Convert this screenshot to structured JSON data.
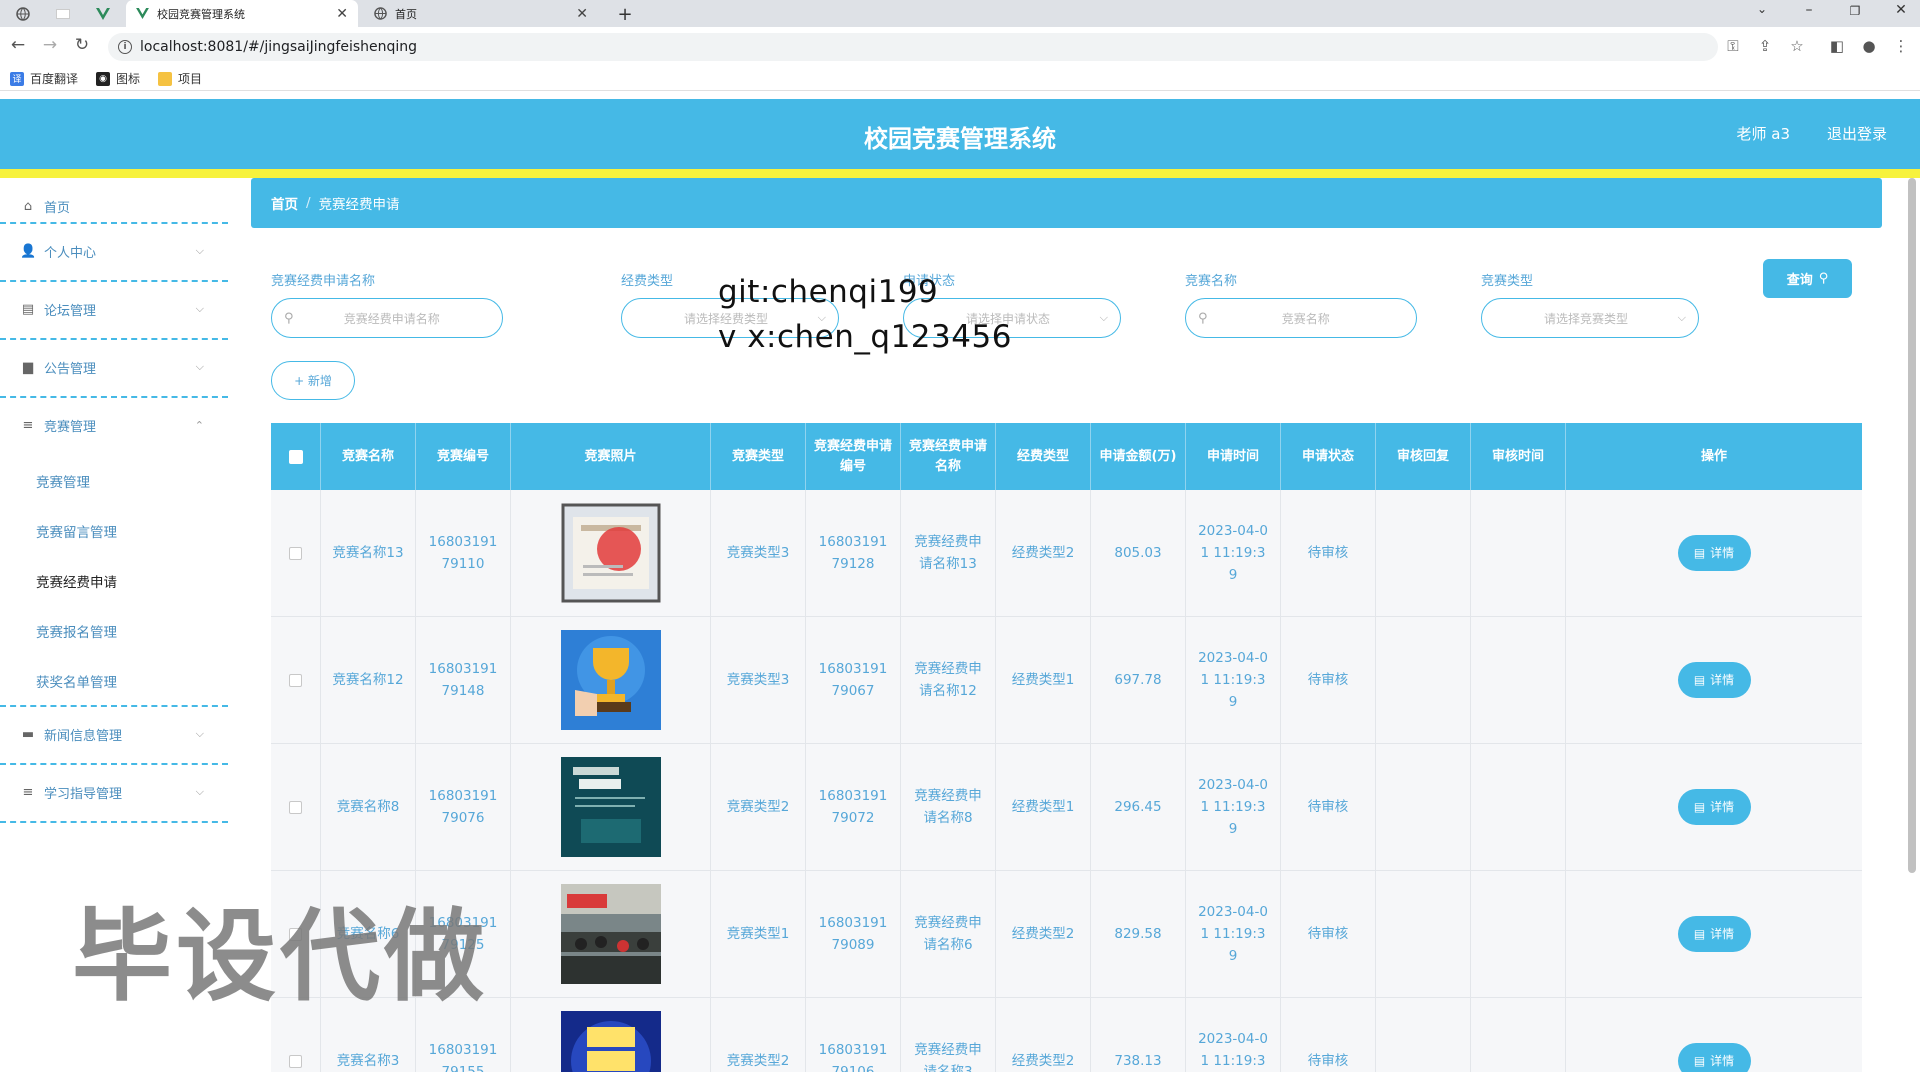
{
  "browser": {
    "tabs": [
      {
        "title": "校园竞赛管理系统",
        "active": true
      },
      {
        "title": "首页",
        "active": false
      }
    ],
    "url": "localhost:8081/#/jingsaiJingfeishenqing",
    "bookmarks": [
      "百度翻译",
      "图标",
      "项目"
    ]
  },
  "header": {
    "title": "校园竞赛管理系统",
    "user": "老师 a3",
    "logout": "退出登录"
  },
  "sidebar": {
    "items": [
      {
        "label": "首页",
        "icon": "home-icon"
      },
      {
        "label": "个人中心",
        "icon": "user-icon"
      },
      {
        "label": "论坛管理",
        "icon": "forum-icon"
      },
      {
        "label": "公告管理",
        "icon": "briefcase-icon"
      },
      {
        "label": "竞赛管理",
        "icon": "list-icon"
      },
      {
        "label": "新闻信息管理",
        "icon": "chat-icon"
      },
      {
        "label": "学习指导管理",
        "icon": "list-icon"
      }
    ],
    "sub_items": [
      "竞赛管理",
      "竞赛留言管理",
      "竞赛经费申请",
      "竞赛报名管理",
      "获奖名单管理"
    ],
    "active_sub": "竞赛经费申请"
  },
  "breadcrumb": {
    "home": "首页",
    "current": "竞赛经费申请"
  },
  "search": {
    "fields": [
      {
        "label": "竞赛经费申请名称",
        "placeholder": "竞赛经费申请名称",
        "type": "input"
      },
      {
        "label": "经费类型",
        "placeholder": "请选择经费类型",
        "type": "select"
      },
      {
        "label": "申请状态",
        "placeholder": "请选择申请状态",
        "type": "select"
      },
      {
        "label": "竞赛名称",
        "placeholder": "竞赛名称",
        "type": "input"
      },
      {
        "label": "竞赛类型",
        "placeholder": "请选择竞赛类型",
        "type": "select"
      }
    ],
    "query_label": "查询",
    "add_label": "+ 新增"
  },
  "table": {
    "columns": [
      "",
      "竞赛名称",
      "竞赛编号",
      "竞赛照片",
      "竞赛类型",
      "竞赛经费申请编号",
      "竞赛经费申请名称",
      "经费类型",
      "申请金额(万)",
      "申请时间",
      "申请状态",
      "审核回复",
      "审核时间",
      "操作"
    ],
    "detail_label": "详情",
    "rows": [
      {
        "name": "竞赛名称13",
        "code": "1680319179110",
        "image": "certificate",
        "type": "竞赛类型3",
        "apply_code": "1680319179128",
        "apply_name": "竞赛经费申请名称13",
        "fee_type": "经费类型2",
        "amount": "805.03",
        "time": "2023-04-01 11:19:39",
        "status": "待审核"
      },
      {
        "name": "竞赛名称12",
        "code": "1680319179148",
        "image": "trophy",
        "type": "竞赛类型3",
        "apply_code": "1680319179067",
        "apply_name": "竞赛经费申请名称12",
        "fee_type": "经费类型1",
        "amount": "697.78",
        "time": "2023-04-01 11:19:39",
        "status": "待审核"
      },
      {
        "name": "竞赛名称8",
        "code": "1680319179076",
        "image": "poster",
        "type": "竞赛类型2",
        "apply_code": "1680319179072",
        "apply_name": "竞赛经费申请名称8",
        "fee_type": "经费类型1",
        "amount": "296.45",
        "time": "2023-04-01 11:19:39",
        "status": "待审核"
      },
      {
        "name": "竞赛名称6",
        "code": "1680319179125",
        "image": "meeting",
        "type": "竞赛类型1",
        "apply_code": "1680319179089",
        "apply_name": "竞赛经费申请名称6",
        "fee_type": "经费类型2",
        "amount": "829.58",
        "time": "2023-04-01 11:19:39",
        "status": "待审核"
      },
      {
        "name": "竞赛名称3",
        "code": "1680319179155",
        "image": "quiz",
        "type": "竞赛类型2",
        "apply_code": "1680319179106",
        "apply_name": "竞赛经费申请名称3",
        "fee_type": "经费类型2",
        "amount": "738.13",
        "time": "2023-04-01 11:19:39",
        "status": "待审核"
      }
    ]
  },
  "overlays": {
    "line1": "git:chenqi199",
    "line2": "v x:chen_q123456",
    "big": "毕设代做"
  },
  "colors": {
    "primary": "#45b9e6",
    "accent_yellow": "#f7f23d",
    "link": "#56a7d8"
  }
}
